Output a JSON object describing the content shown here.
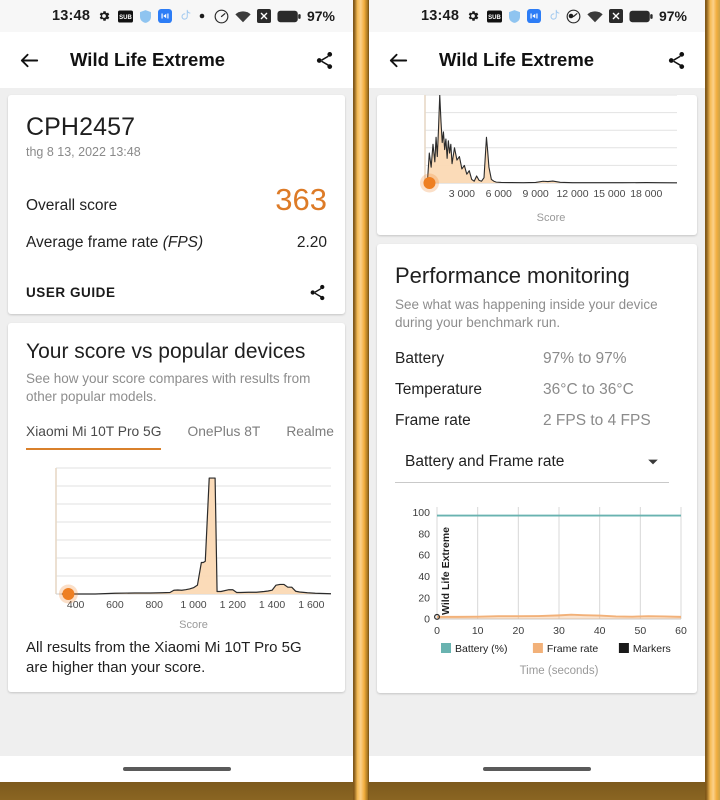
{
  "statusbar": {
    "time": "13:48",
    "battery_percent": "97%",
    "left_icons": [
      "gear-icon",
      "subtitles-icon",
      "shield-icon",
      "messenger-icon",
      "tiktok-icon",
      "dot-icon"
    ],
    "right_icons": [
      "data-saver-icon",
      "wifi-icon",
      "no-sim-icon",
      "battery-icon"
    ]
  },
  "appbar": {
    "title": "Wild Life Extreme",
    "back_icon": "back-arrow-icon",
    "share_icon": "share-icon"
  },
  "colors": {
    "accent_orange": "#DD7B27",
    "tab_underline": "#D9802B",
    "fill_orange": "#FBD9B4",
    "battery_teal": "#69B3B0",
    "frame_rate_orange": "#F2B179",
    "markers_black": "#1A1A1A",
    "page_gold": "#F9AE49"
  },
  "left_panel": {
    "score_card": {
      "device_name": "CPH2457",
      "date": "thg 8 13, 2022 13:48",
      "overall_score_label": "Overall score",
      "overall_score_value": "363",
      "frame_rate_label": "Average frame rate",
      "frame_rate_label_italic": "(FPS)",
      "frame_rate_value": "2.20",
      "user_guide_label": "USER GUIDE",
      "share_icon": "share-icon"
    },
    "compare_card": {
      "title": "Your score vs popular devices",
      "subtitle": "See how your score compares with results from other popular models.",
      "tabs": [
        {
          "label": "Xiaomi Mi 10T Pro 5G",
          "active": true
        },
        {
          "label": "OnePlus 8T",
          "active": false
        },
        {
          "label": "Realme",
          "active": false
        }
      ],
      "note": "All results from the Xiaomi Mi 10T Pro 5G are higher than your score."
    }
  },
  "right_panel": {
    "perf_card": {
      "title": "Performance monitoring",
      "subtitle": "See what was happening inside your device during your benchmark run.",
      "rows": [
        {
          "key": "Battery",
          "value": "97% to 97%"
        },
        {
          "key": "Temperature",
          "value": "36°C to 36°C"
        },
        {
          "key": "Frame rate",
          "value": "2 FPS to 4 FPS"
        }
      ],
      "select_value": "Battery and Frame rate",
      "select_icon": "chevron-down-icon"
    }
  },
  "chart_data": [
    {
      "id": "left-distribution",
      "type": "area",
      "title": "",
      "xlabel": "Score",
      "ylabel": "",
      "xlim": [
        300,
        1700
      ],
      "ylim": [
        0,
        100
      ],
      "grid": true,
      "xticks": [
        400,
        600,
        800,
        1000,
        1200,
        1400,
        1600
      ],
      "xtick_labels": [
        "400",
        "600",
        "800",
        "1 000",
        "1 200",
        "1 400",
        "1 600"
      ],
      "marker": {
        "x": 363,
        "y": 0,
        "label": "your score",
        "color": "#EE7F22"
      },
      "x": [
        330,
        400,
        500,
        600,
        700,
        780,
        840,
        880,
        900,
        920,
        940,
        960,
        980,
        1000,
        1020,
        1040,
        1050,
        1060,
        1080,
        1100,
        1110,
        1120,
        1140,
        1180,
        1200,
        1220,
        1240,
        1280,
        1320,
        1360,
        1380,
        1400,
        1420,
        1440,
        1460,
        1480,
        1500,
        1520,
        1540,
        1580,
        1620,
        1660,
        1700
      ],
      "y": [
        0,
        0,
        0,
        0.6,
        0.8,
        0.8,
        1.0,
        1.2,
        3.0,
        3.2,
        3.0,
        3.4,
        4.0,
        5.0,
        7.0,
        25,
        25,
        26,
        92,
        92,
        92,
        2.0,
        2.0,
        3.4,
        3.4,
        1.2,
        1.2,
        1.4,
        1.4,
        2.0,
        2.4,
        3.0,
        7.0,
        7.6,
        7.6,
        5.4,
        5.4,
        2.2,
        1.6,
        1.0,
        0.6,
        0.4,
        0.2
      ]
    },
    {
      "id": "right-distribution",
      "type": "area",
      "title": "",
      "xlabel": "Score",
      "ylabel": "",
      "xlim": [
        0,
        20500
      ],
      "ylim": [
        0,
        100
      ],
      "grid": true,
      "xticks": [
        3000,
        6000,
        9000,
        12000,
        15000,
        18000
      ],
      "xtick_labels": [
        "3 000",
        "6 000",
        "9 000",
        "12 000",
        "15 000",
        "18 000"
      ],
      "marker": {
        "x": 363,
        "y": 0,
        "label": "your score",
        "color": "#EE7F22"
      },
      "x": [
        200,
        350,
        500,
        650,
        800,
        900,
        1000,
        1100,
        1200,
        1300,
        1400,
        1500,
        1600,
        1700,
        1800,
        1900,
        2000,
        2100,
        2200,
        2400,
        2600,
        2800,
        3000,
        3200,
        3400,
        3600,
        3800,
        4000,
        4200,
        4400,
        4600,
        4800,
        5000,
        5100,
        5200,
        5400,
        5600,
        5800,
        6200,
        7000,
        8000,
        9000,
        9600,
        10000,
        10400,
        11000,
        12000,
        14000,
        16000,
        18000,
        19000,
        20500
      ],
      "y": [
        2,
        34,
        18,
        44,
        24,
        52,
        30,
        62,
        100,
        70,
        46,
        58,
        38,
        50,
        28,
        48,
        34,
        44,
        22,
        40,
        26,
        30,
        16,
        20,
        10,
        14,
        4,
        2,
        8,
        3,
        2,
        6,
        52,
        36,
        18,
        4,
        2,
        1,
        0.6,
        0.5,
        0.4,
        0.6,
        2.0,
        1.6,
        2.2,
        0.8,
        0.4,
        0.3,
        0.3,
        0.5,
        0.3,
        0.2
      ]
    },
    {
      "id": "perf-monitor",
      "type": "line",
      "title": "",
      "xlabel": "Time (seconds)",
      "ylabel": "Wild Life Extreme",
      "xlim": [
        0,
        60
      ],
      "ylim": [
        0,
        105
      ],
      "grid": true,
      "xticks": [
        0,
        10,
        20,
        30,
        40,
        50,
        60
      ],
      "xtick_labels": [
        "0",
        "10",
        "20",
        "30",
        "40",
        "50",
        "60"
      ],
      "yticks": [
        0,
        20,
        40,
        60,
        80,
        100
      ],
      "ytick_labels": [
        "0",
        "20",
        "40",
        "60",
        "80",
        "100"
      ],
      "legend_position": "bottom",
      "legend": [
        {
          "name": "Battery (%)",
          "color": "#69B3B0",
          "marker": "square"
        },
        {
          "name": "Frame rate",
          "color": "#F2B179",
          "marker": "square"
        },
        {
          "name": "Markers",
          "color": "#1A1A1A",
          "marker": "square"
        }
      ],
      "series": [
        {
          "name": "Battery (%)",
          "color": "#69B3B0",
          "x": [
            0,
            10,
            20,
            30,
            40,
            50,
            60
          ],
          "values": [
            97,
            97,
            97,
            97,
            97,
            97,
            97
          ]
        },
        {
          "name": "Frame rate",
          "color": "#F2B179",
          "x": [
            0,
            5,
            10,
            15,
            20,
            25,
            30,
            33,
            36,
            40,
            44,
            48,
            52,
            56,
            60
          ],
          "values": [
            2,
            2,
            2.2,
            2.6,
            2.6,
            2.8,
            3.4,
            4.0,
            3.6,
            3.2,
            2.4,
            2.2,
            2.6,
            2.4,
            2.0
          ]
        }
      ]
    }
  ]
}
